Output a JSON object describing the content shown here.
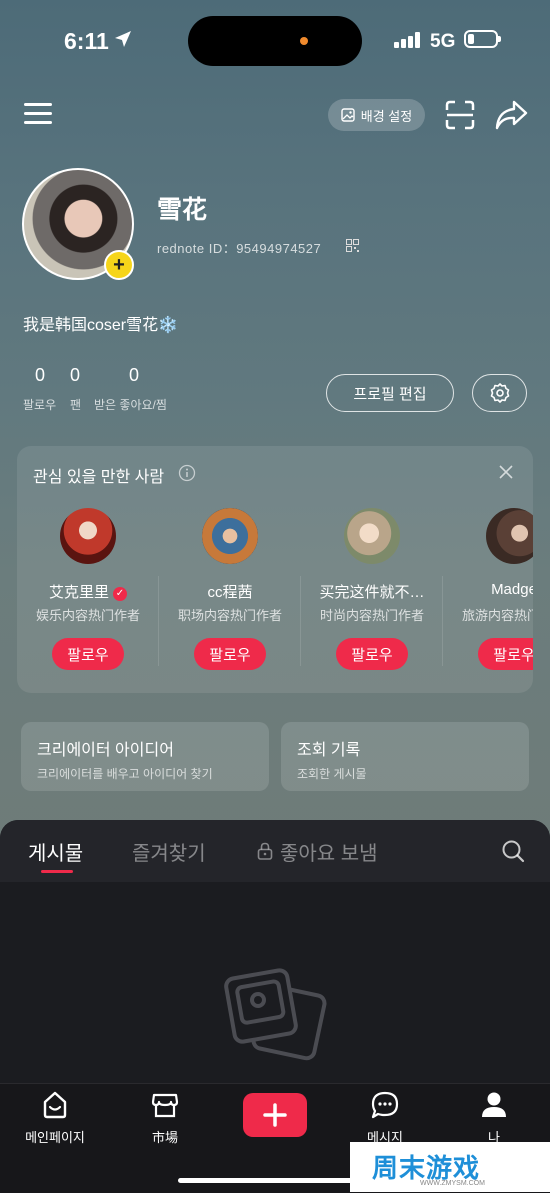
{
  "status_bar": {
    "time": "6:11",
    "network": "5G"
  },
  "header": {
    "background_button": "배경 설정"
  },
  "profile": {
    "name": "雪花",
    "rednote_id": "rednote ID：95494974527",
    "bio": "我是韩国coser雪花❄️",
    "stats": [
      {
        "value": "0",
        "label": "팔로우"
      },
      {
        "value": "0",
        "label": "팬"
      },
      {
        "value": "0",
        "label": "받은 좋아요/찜"
      }
    ],
    "edit_button": "프로필 편집"
  },
  "recommend": {
    "title": "관심 있을 만한 사람",
    "users": [
      {
        "name": "艾克里里",
        "desc": "娱乐内容热门作者",
        "follow": "팔로우",
        "verified": true
      },
      {
        "name": "cc程茜",
        "desc": "职场内容热门作者",
        "follow": "팔로우",
        "verified": false
      },
      {
        "name": "买完这件就不…",
        "desc": "时尚内容热门作者",
        "follow": "팔로우",
        "verified": false
      },
      {
        "name": "Madge",
        "desc": "旅游内容热门作者",
        "follow": "팔로우",
        "verified": false
      }
    ]
  },
  "tiles": [
    {
      "title": "크리에이터 아이디어",
      "subtitle": "크리에이터를 배우고 아이디어 찾기"
    },
    {
      "title": "조회 기록",
      "subtitle": "조회한 게시물"
    }
  ],
  "tabs": [
    {
      "label": "게시물"
    },
    {
      "label": "즐겨찾기"
    },
    {
      "label": "좋아요 보냄"
    }
  ],
  "nav": [
    {
      "label": "메인페이지"
    },
    {
      "label": "市場"
    },
    {
      "label": "메시지"
    },
    {
      "label": "나"
    }
  ],
  "watermark": {
    "text": "周末游戏",
    "url": "WWW.ZMYSM.COM"
  },
  "colors": {
    "accent": "#ef2a4a",
    "badge": "#f6d51a"
  }
}
